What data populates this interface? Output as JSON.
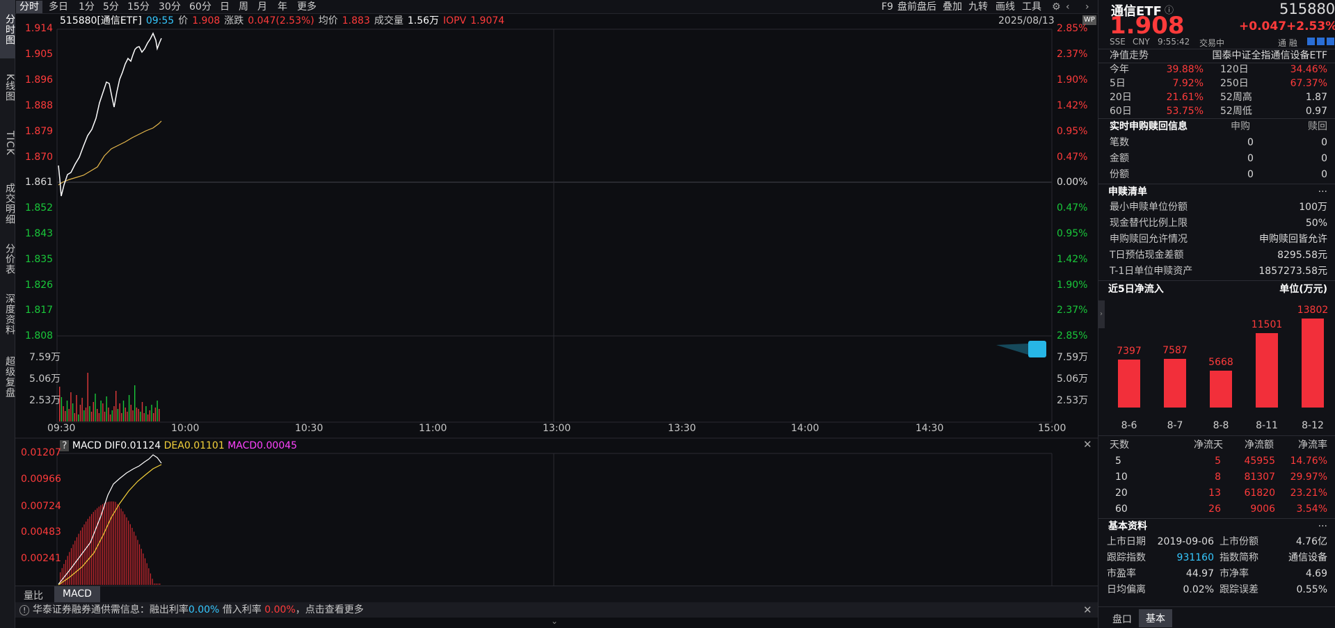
{
  "toolbar": {
    "tabs": [
      "分时",
      "多日",
      "1分",
      "5分",
      "15分",
      "30分",
      "60分",
      "日",
      "周",
      "月",
      "年",
      "更多"
    ],
    "right": [
      "F9",
      "盘前盘后",
      "叠加",
      "九转",
      "画线",
      "工具"
    ]
  },
  "left_tabs": [
    "分时图",
    "K线图",
    "TICK",
    "成交明细",
    "分价表",
    "深度资料",
    "超级复盘"
  ],
  "info": {
    "code_name": "515880[通信ETF]",
    "time": "09:55",
    "price_label": "价",
    "price": "1.908",
    "change_label": "涨跌",
    "change": "0.047(2.53%)",
    "avg_label": "均价",
    "avg": "1.883",
    "vol_label": "成交量",
    "vol": "1.56万",
    "iopv_label": "IOPV",
    "iopv": "1.9074",
    "date": "2025/08/13"
  },
  "price_axis": {
    "left": [
      "1.914",
      "1.905",
      "1.896",
      "1.888",
      "1.879",
      "1.870",
      "1.861",
      "1.852",
      "1.843",
      "1.835",
      "1.826",
      "1.817",
      "1.808"
    ],
    "right": [
      "2.85%",
      "2.37%",
      "1.90%",
      "1.42%",
      "0.95%",
      "0.47%",
      "0.00%",
      "0.47%",
      "0.95%",
      "1.42%",
      "1.90%",
      "2.37%",
      "2.85%"
    ]
  },
  "volume_axis": {
    "left": [
      "7.59万",
      "5.06万",
      "2.53万"
    ],
    "right": [
      "7.59万",
      "5.06万",
      "2.53万"
    ]
  },
  "time_axis": [
    "09:30",
    "10:00",
    "10:30",
    "11:00",
    "13:00",
    "13:30",
    "14:00",
    "14:30",
    "15:00"
  ],
  "macd": {
    "help": "?",
    "title": "MACD",
    "dif_label": "DIF",
    "dif": "0.01124",
    "dea_label": "DEA",
    "dea": "0.01101",
    "macd_label": "MACD",
    "macd": "0.00045",
    "axis": [
      "0.01207",
      "0.00966",
      "0.00724",
      "0.00483",
      "0.00241"
    ]
  },
  "bottom_left_tabs": [
    "量比",
    "MACD"
  ],
  "notice": {
    "text": "华泰证券融券通供需信息：融出利率",
    "rate1": "0.00%",
    "mid": "借入利率",
    "rate2": "0.00%",
    "tail": "，点击查看更多"
  },
  "panel": {
    "name": "通信ETF",
    "code": "515880",
    "price": "1.908",
    "change": "+0.047",
    "change_pct": "+2.53%",
    "exchange": "SSE",
    "currency": "CNY",
    "time": "9:55:42",
    "status": "交易中",
    "flags": "通 融",
    "nav_title": "净值走势",
    "index_name": "国泰中证全指通信设备ETF",
    "perf": [
      {
        "l1": "今年",
        "v1": "39.88%",
        "l2": "120日",
        "v2": "34.46%"
      },
      {
        "l1": "5日",
        "v1": "7.92%",
        "l2": "250日",
        "v2": "67.37%"
      },
      {
        "l1": "20日",
        "v1": "21.61%",
        "l2": "52周高",
        "v2": "1.87"
      },
      {
        "l1": "60日",
        "v1": "53.75%",
        "l2": "52周低",
        "v2": "0.97"
      }
    ],
    "redeem_title": "实时申购赎回信息",
    "redeem_cols": [
      "申购",
      "赎回"
    ],
    "redeem_rows": [
      {
        "label": "笔数",
        "buy": "0",
        "sell": "0"
      },
      {
        "label": "金额",
        "buy": "0",
        "sell": "0"
      },
      {
        "label": "份额",
        "buy": "0",
        "sell": "0"
      }
    ],
    "list_title": "申赎清单",
    "more": "···",
    "list_rows": [
      {
        "label": "最小申赎单位份额",
        "value": "100万"
      },
      {
        "label": "现金替代比例上限",
        "value": "50%"
      },
      {
        "label": "申购赎回允许情况",
        "value": "申购赎回皆允许"
      },
      {
        "label": "T日预估现金差额",
        "value": "8295.58元"
      },
      {
        "label": "T-1日单位申赎资产",
        "value": "1857273.58元"
      }
    ],
    "flow_title": "近5日净流入",
    "flow_unit": "单位(万元)",
    "flow_bars": [
      {
        "date": "8-6",
        "value": 7397
      },
      {
        "date": "8-7",
        "value": 7587
      },
      {
        "date": "8-8",
        "value": 5668
      },
      {
        "date": "8-11",
        "value": 11501
      },
      {
        "date": "8-12",
        "value": 13802
      }
    ],
    "flow_cols": [
      "天数",
      "净流天",
      "净流额",
      "净流率"
    ],
    "flow_rows": [
      {
        "days": "5",
        "net_days": "5",
        "net_amt": "45955",
        "rate": "14.76%"
      },
      {
        "days": "10",
        "net_days": "8",
        "net_amt": "81307",
        "rate": "29.97%"
      },
      {
        "days": "20",
        "net_days": "13",
        "net_amt": "61820",
        "rate": "23.21%"
      },
      {
        "days": "60",
        "net_days": "26",
        "net_amt": "9006",
        "rate": "3.54%"
      }
    ],
    "basic_title": "基本资料",
    "basic": [
      {
        "l1": "上市日期",
        "v1": "2019-09-06",
        "l2": "上市份额",
        "v2": "4.76亿"
      },
      {
        "l1": "跟踪指数",
        "v1": "931160",
        "l2": "指数简称",
        "v2": "通信设备"
      },
      {
        "l1": "市盈率",
        "v1": "44.97",
        "l2": "市净率",
        "v2": "4.69"
      },
      {
        "l1": "日均偏离",
        "v1": "0.02%",
        "l2": "跟踪误差",
        "v2": "0.55%"
      }
    ],
    "tabs": [
      "盘口",
      "基本"
    ]
  },
  "colors": {
    "up": "#ff3b3b",
    "down": "#19c93a",
    "avg": "#e6b84c",
    "dea": "#f5d23a",
    "macd": "#ff43ff"
  }
}
